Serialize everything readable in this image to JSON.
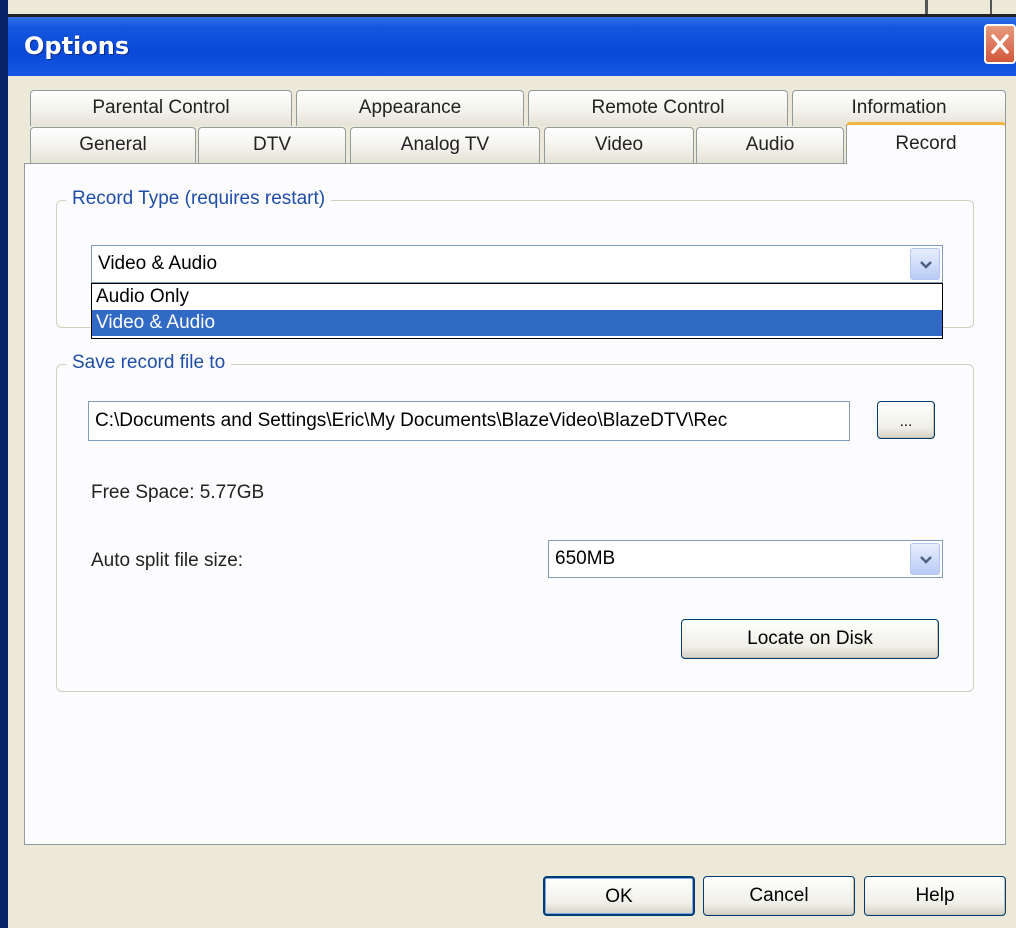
{
  "window": {
    "title": "Options"
  },
  "tabs_back_row": [
    {
      "label": "Parental Control"
    },
    {
      "label": "Appearance"
    },
    {
      "label": "Remote Control"
    },
    {
      "label": "Information"
    }
  ],
  "tabs_front_row": [
    {
      "label": "General"
    },
    {
      "label": "DTV"
    },
    {
      "label": "Analog TV"
    },
    {
      "label": "Video"
    },
    {
      "label": "Audio"
    },
    {
      "label": "Record",
      "active": true
    }
  ],
  "record_type": {
    "group_label": "Record Type (requires restart)",
    "selected_value": "Video & Audio",
    "options": [
      "Audio Only",
      "Video & Audio"
    ]
  },
  "save_location": {
    "group_label": "Save record file to",
    "path": "C:\\Documents and Settings\\Eric\\My Documents\\BlazeVideo\\BlazeDTV\\Rec",
    "browse_label": "...",
    "free_space": "Free Space: 5.77GB",
    "auto_split_label": "Auto split file size:",
    "auto_split_value": "650MB",
    "locate_label": "Locate on Disk"
  },
  "footer": {
    "ok_label": "OK",
    "cancel_label": "Cancel",
    "help_label": "Help"
  }
}
